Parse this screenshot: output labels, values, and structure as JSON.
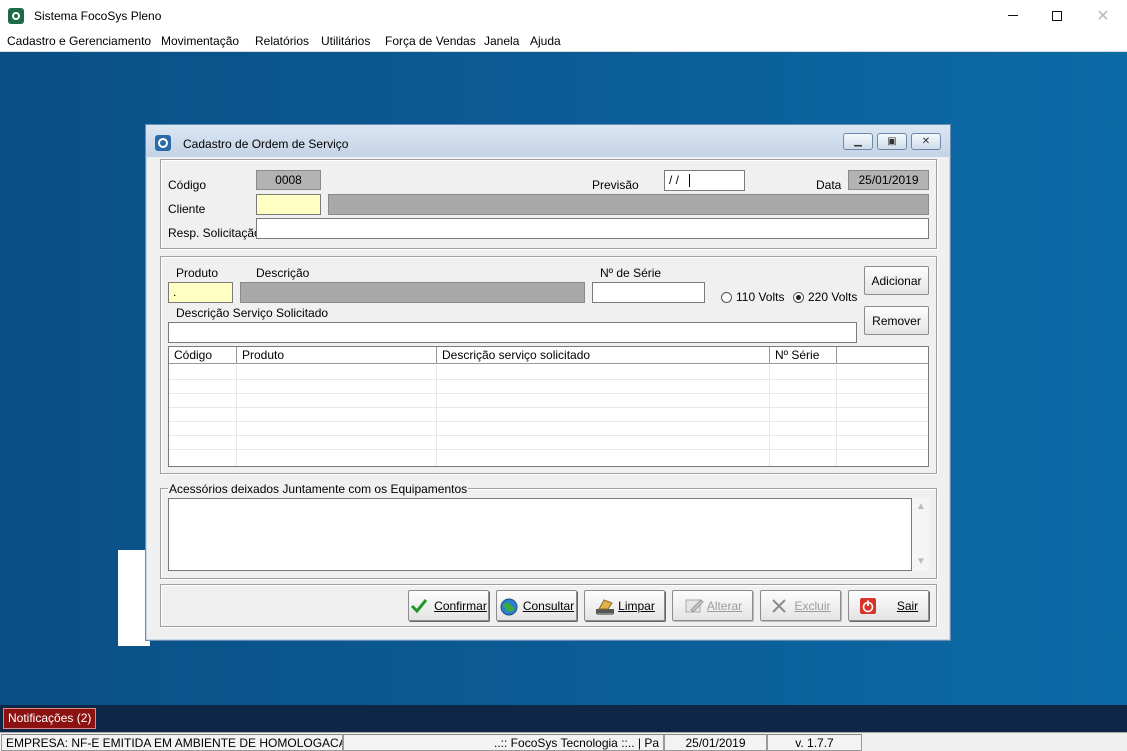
{
  "window": {
    "title": "Sistema FocoSys Pleno",
    "menu": [
      "Cadastro e Gerenciamento",
      "Movimentação",
      "Relatórios",
      "Utilitários",
      "Força de Vendas",
      "Janela",
      "Ajuda"
    ]
  },
  "dialog": {
    "title": "Cadastro de Ordem de Serviço",
    "header": {
      "codigo_label": "Código",
      "codigo_value": "0008",
      "previsao_label": "Previsão",
      "previsao_value": "/ /",
      "data_label": "Data",
      "data_value": "25/01/2019",
      "cliente_label": "Cliente",
      "cliente_value": "",
      "cliente_nome": "",
      "resp_label": "Resp. Solicitação",
      "resp_value": ""
    },
    "item": {
      "produto_label": "Produto",
      "produto_value": ".",
      "descricao_label": "Descrição",
      "descricao_value": "",
      "serie_label": "Nº de Série",
      "serie_value": "",
      "voltage_110": "110 Volts",
      "voltage_220": "220 Volts",
      "voltage_selected": "220 Volts",
      "servico_label": "Descrição Serviço Solicitado",
      "servico_value": "",
      "add_label": "Adicionar",
      "remove_label": "Remover"
    },
    "grid": {
      "columns": [
        "Código",
        "Produto",
        "Descrição serviço solicitado",
        "Nº Série",
        ""
      ],
      "rows": []
    },
    "acessorios": {
      "label": "Acessórios deixados Juntamente com os Equipamentos",
      "value": ""
    },
    "buttons": {
      "confirmar": "Confirmar",
      "consultar": "Consultar",
      "limpar": "Limpar",
      "alterar": "Alterar",
      "excluir": "Excluir",
      "sair": "Sair"
    }
  },
  "notifications": {
    "label": "Notificações (2)"
  },
  "status": {
    "empresa": "EMPRESA: NF-E EMITIDA EM AMBIENTE DE HOMOLOGACAO",
    "company": "..:: FocoSys Tecnologia ::.. | Pa",
    "date": "25/01/2019",
    "version": "v. 1.7.7"
  },
  "colors": {
    "desktop": "#0b5a94",
    "required_field": "#ffffc4",
    "readonly_field": "#a9a9a9",
    "notification": "#8c1111"
  }
}
